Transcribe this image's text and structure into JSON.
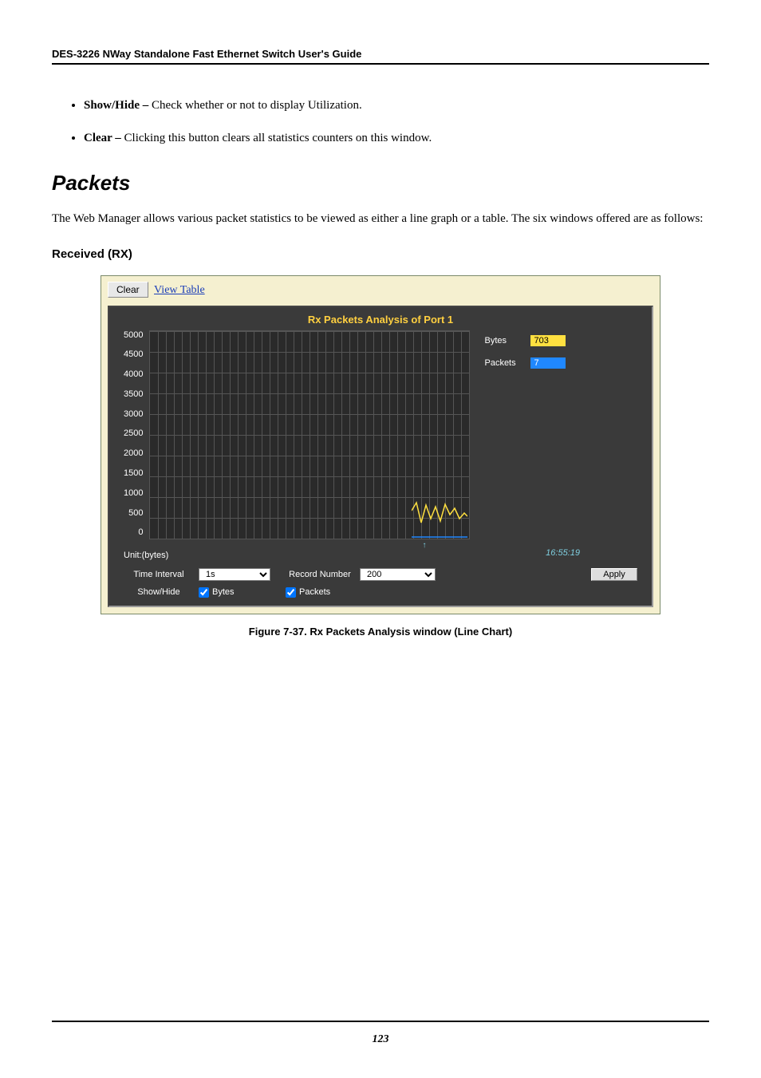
{
  "header": {
    "doc_title": "DES-3226 NWay Standalone Fast Ethernet Switch User's Guide"
  },
  "bullets": [
    {
      "term": "Show/Hide – ",
      "desc": "Check whether or not to display Utilization."
    },
    {
      "term": "Clear – ",
      "desc": "Clicking this button clears all statistics counters on this window."
    }
  ],
  "section_heading": "Packets",
  "body_text": "The Web Manager allows various packet statistics to be viewed as either a line graph or a table. The six windows offered are as follows:",
  "subheading": "Received (RX)",
  "screenshot": {
    "toolbar": {
      "clear": "Clear",
      "view_table": "View Table"
    },
    "chart_title": "Rx Packets Analysis of Port 1",
    "y_ticks": [
      "5000",
      "4500",
      "4000",
      "3500",
      "3000",
      "2500",
      "2000",
      "1500",
      "1000",
      "500",
      "0"
    ],
    "legend": {
      "bytes_label": "Bytes",
      "bytes_value": "703",
      "packets_label": "Packets",
      "packets_value": "7"
    },
    "x_timestamp": "16:55:19",
    "unit_label": "Unit:(bytes)",
    "form": {
      "time_interval_label": "Time Interval",
      "time_interval_value": "1s",
      "record_number_label": "Record Number",
      "record_number_value": "200",
      "apply_label": "Apply",
      "show_hide_label": "Show/Hide",
      "check_bytes_label": "Bytes",
      "check_packets_label": "Packets"
    }
  },
  "figure_caption": "Figure 7-37.  Rx Packets Analysis window (Line Chart)",
  "page_number": "123",
  "chart_data": {
    "type": "line",
    "title": "Rx Packets Analysis of Port 1",
    "xlabel": "",
    "ylabel": "",
    "ylim": [
      0,
      5000
    ],
    "y_ticks": [
      0,
      500,
      1000,
      1500,
      2000,
      2500,
      3000,
      3500,
      4000,
      4500,
      5000
    ],
    "x_annotation": "16:55:19",
    "unit": "bytes",
    "series": [
      {
        "name": "Bytes",
        "current_value": 703,
        "color": "#ffe040"
      },
      {
        "name": "Packets",
        "current_value": 7,
        "color": "#2088ff"
      }
    ]
  }
}
